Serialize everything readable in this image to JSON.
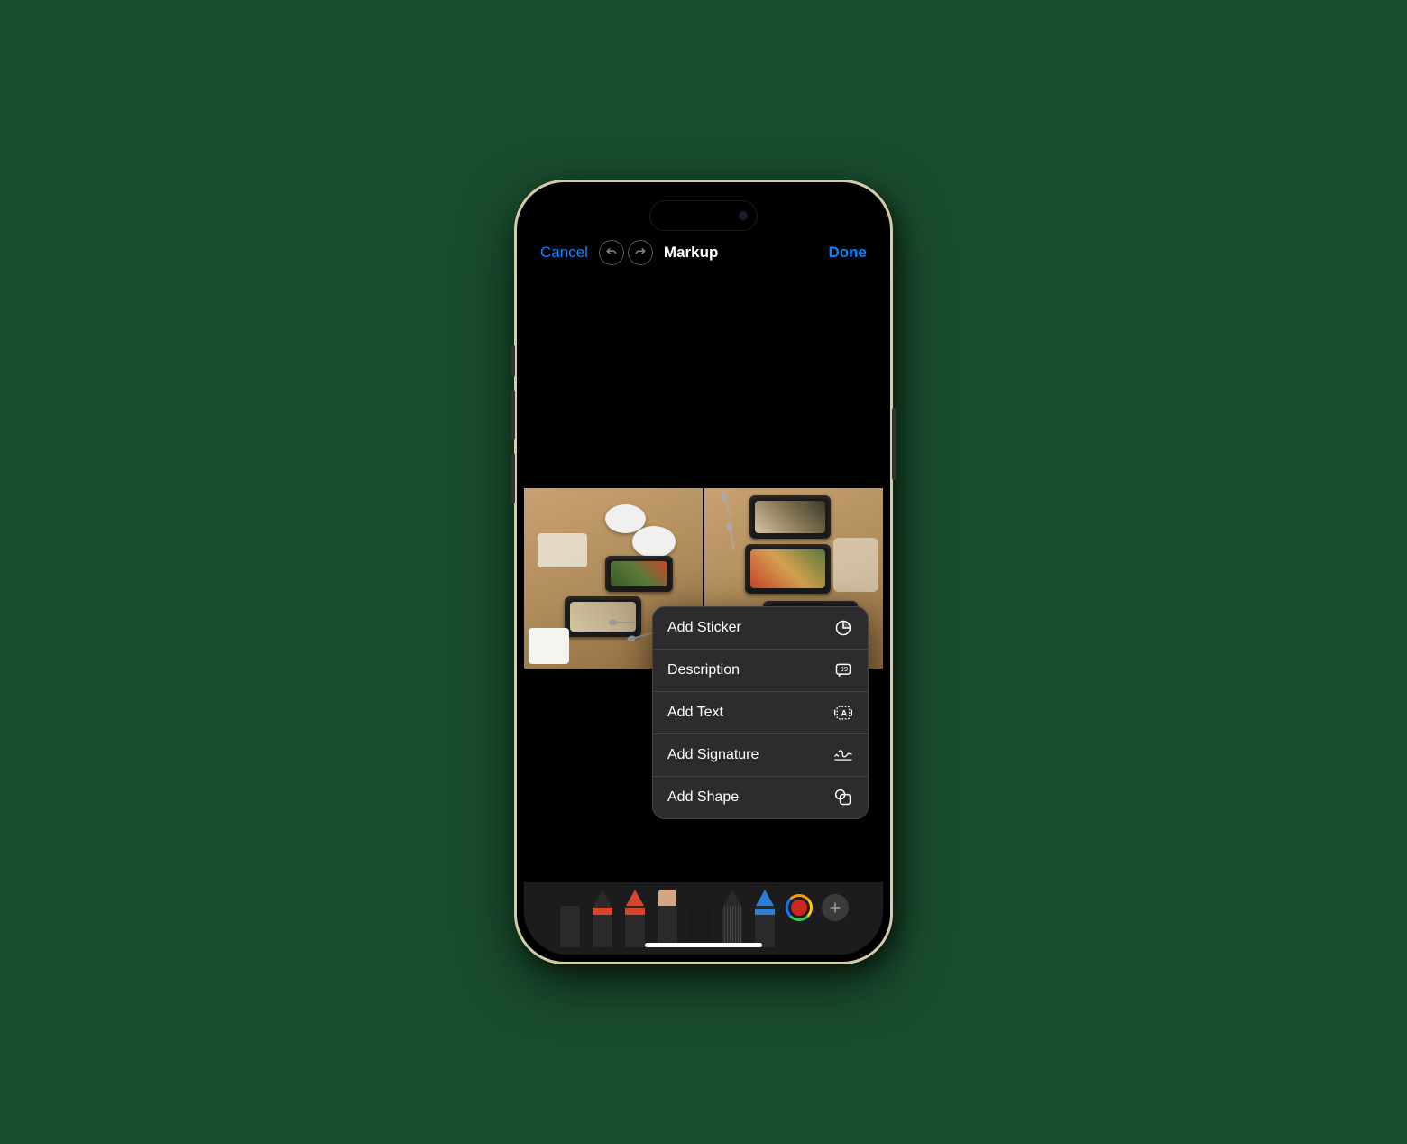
{
  "nav": {
    "cancel": "Cancel",
    "title": "Markup",
    "done": "Done"
  },
  "menu": {
    "items": [
      {
        "label": "Add Sticker",
        "icon": "sticker-icon"
      },
      {
        "label": "Description",
        "icon": "description-icon"
      },
      {
        "label": "Add Text",
        "icon": "text-icon"
      },
      {
        "label": "Add Signature",
        "icon": "signature-icon"
      },
      {
        "label": "Add Shape",
        "icon": "shape-icon"
      }
    ]
  },
  "toolbar": {
    "tools": [
      {
        "name": "pen-tool"
      },
      {
        "name": "marker-tool"
      },
      {
        "name": "pencil-tool"
      },
      {
        "name": "eraser-tool"
      },
      {
        "name": "lasso-tool"
      },
      {
        "name": "ruler-tool"
      },
      {
        "name": "crayon-tool"
      }
    ],
    "selected_color": "#c8291f"
  }
}
